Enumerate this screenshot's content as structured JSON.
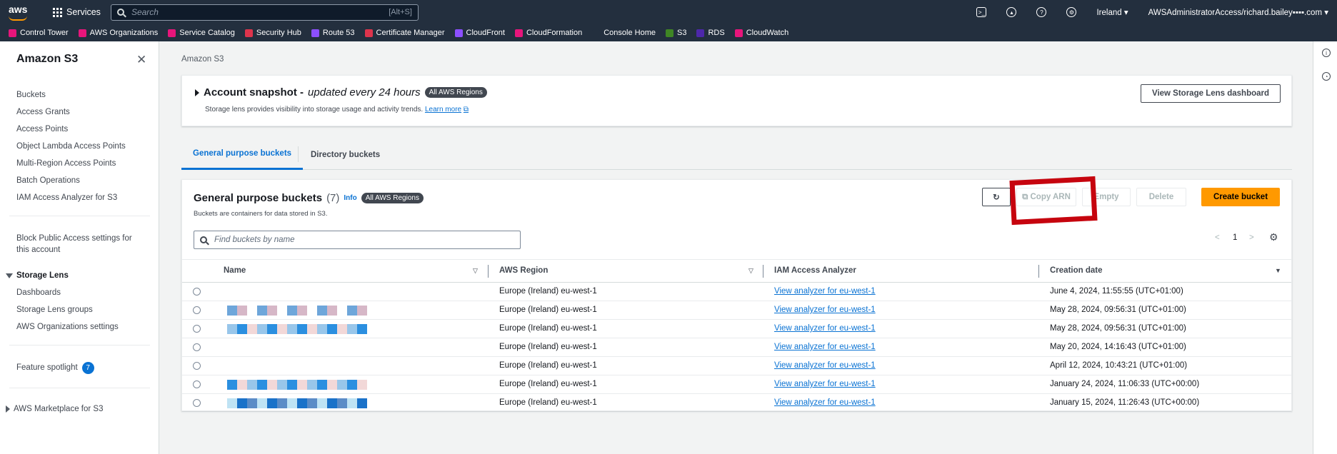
{
  "topnav": {
    "logo": "aws",
    "services": "Services",
    "search_placeholder": "Search",
    "search_shortcut": "[Alt+S]",
    "region": "Ireland ▾",
    "account": "AWSAdministratorAccess/richard.bailey▪▪▪▪.com ▾"
  },
  "favorites": [
    {
      "label": "Control Tower",
      "color": "#e7157b"
    },
    {
      "label": "AWS Organizations",
      "color": "#e7157b"
    },
    {
      "label": "Service Catalog",
      "color": "#e7157b"
    },
    {
      "label": "Security Hub",
      "color": "#dd344c"
    },
    {
      "label": "Route 53",
      "color": "#8c4fff"
    },
    {
      "label": "Certificate Manager",
      "color": "#dd344c"
    },
    {
      "label": "CloudFront",
      "color": "#8c4fff"
    },
    {
      "label": "CloudFormation",
      "color": "#e7157b"
    },
    {
      "label": "Console Home",
      "color": "#232f3e"
    },
    {
      "label": "S3",
      "color": "#3f8624"
    },
    {
      "label": "RDS",
      "color": "#4d27aa"
    },
    {
      "label": "CloudWatch",
      "color": "#e7157b"
    }
  ],
  "sidebar": {
    "title": "Amazon S3",
    "close": "✕",
    "links": [
      "Buckets",
      "Access Grants",
      "Access Points",
      "Object Lambda Access Points",
      "Multi-Region Access Points",
      "Batch Operations",
      "IAM Access Analyzer for S3"
    ],
    "block_public": "Block Public Access settings for this account",
    "storage_lens": "Storage Lens",
    "lens_links": [
      "Dashboards",
      "Storage Lens groups",
      "AWS Organizations settings"
    ],
    "feature_spotlight": "Feature spotlight",
    "feature_count": "7",
    "marketplace": "AWS Marketplace for S3"
  },
  "main": {
    "breadcrumb": "Amazon S3",
    "snapshot": {
      "title": "Account snapshot -",
      "subtitle": "updated every 24 hours",
      "badge": "All AWS Regions",
      "desc": "Storage lens provides visibility into storage usage and activity trends.",
      "learn_more": "Learn more",
      "button": "View Storage Lens dashboard"
    },
    "tabs": [
      "General purpose buckets",
      "Directory buckets"
    ],
    "panel": {
      "title": "General purpose buckets",
      "count": "(7)",
      "info": "Info",
      "badge": "All AWS Regions",
      "desc": "Buckets are containers for data stored in S3.",
      "search_placeholder": "Find buckets by name",
      "buttons": {
        "refresh": "↻",
        "copy_arn": "Copy ARN",
        "empty": "Empty",
        "delete": "Delete",
        "create": "Create bucket"
      },
      "page": "1",
      "columns": [
        "Name",
        "AWS Region",
        "IAM Access Analyzer",
        "Creation date"
      ],
      "rows": [
        {
          "region": "Europe (Ireland) eu-west-1",
          "analyzer": "View analyzer for eu-west-1",
          "date": "June 4, 2024, 11:55:55 (UTC+01:00)"
        },
        {
          "region": "Europe (Ireland) eu-west-1",
          "analyzer": "View analyzer for eu-west-1",
          "date": "May 28, 2024, 09:56:31 (UTC+01:00)"
        },
        {
          "region": "Europe (Ireland) eu-west-1",
          "analyzer": "View analyzer for eu-west-1",
          "date": "May 28, 2024, 09:56:31 (UTC+01:00)"
        },
        {
          "region": "Europe (Ireland) eu-west-1",
          "analyzer": "View analyzer for eu-west-1",
          "date": "May 20, 2024, 14:16:43 (UTC+01:00)"
        },
        {
          "region": "Europe (Ireland) eu-west-1",
          "analyzer": "View analyzer for eu-west-1",
          "date": "April 12, 2024, 10:43:21 (UTC+01:00)"
        },
        {
          "region": "Europe (Ireland) eu-west-1",
          "analyzer": "View analyzer for eu-west-1",
          "date": "January 24, 2024, 11:06:33 (UTC+00:00)"
        },
        {
          "region": "Europe (Ireland) eu-west-1",
          "analyzer": "View analyzer for eu-west-1",
          "date": "January 15, 2024, 11:26:43 (UTC+00:00)"
        }
      ]
    }
  },
  "colors": {
    "accent": "#0972d3",
    "primary_button": "#ff9900",
    "nav_bg": "#232f3e",
    "annotation": "#c6040e"
  }
}
